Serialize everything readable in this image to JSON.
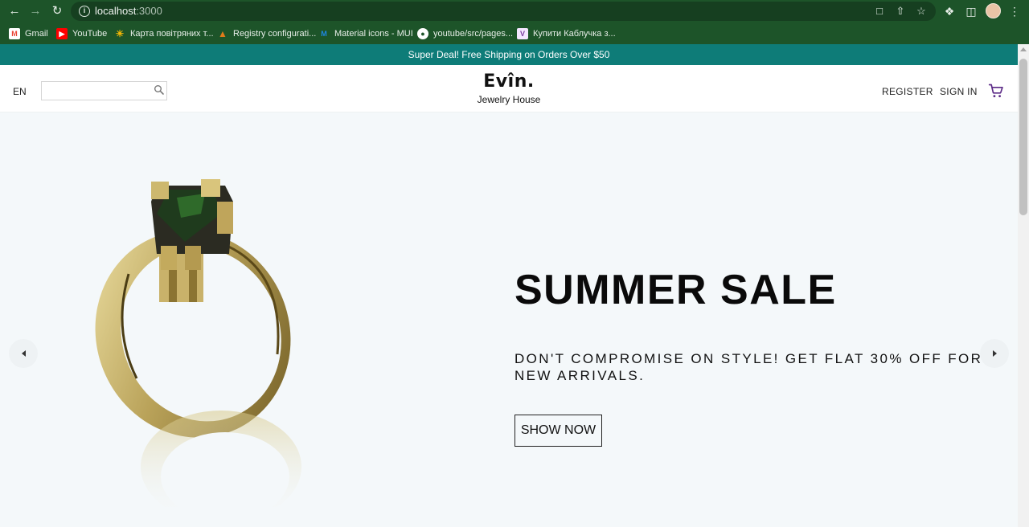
{
  "browser": {
    "url_host": "localhost",
    "url_port": ":3000",
    "bookmarks": [
      {
        "label": "Gmail",
        "icon": "gmail-icon",
        "color": "#ea4335"
      },
      {
        "label": "YouTube",
        "icon": "youtube-icon",
        "color": "#ff0000"
      },
      {
        "label": "Карта повітряних т...",
        "icon": "map-icon",
        "color": "#f2b705"
      },
      {
        "label": "Registry configurati...",
        "icon": "registry-icon",
        "color": "#e07b1a"
      },
      {
        "label": "Material icons - MUI",
        "icon": "mui-icon",
        "color": "#1e88e5"
      },
      {
        "label": "youtube/src/pages...",
        "icon": "github-icon",
        "color": "#ffffff"
      },
      {
        "label": "Купити Каблучка з...",
        "icon": "shop-icon",
        "color": "#7b3fa0"
      }
    ]
  },
  "announcement": "Super Deal! Free Shipping on Orders Over $50",
  "header": {
    "language": "EN",
    "search_placeholder": "",
    "logo_name": "Evîn.",
    "logo_subtitle": "Jewelry House",
    "register": "REGISTER",
    "sign_in": "SIGN IN"
  },
  "slide": {
    "title": "SUMMER SALE",
    "description": "DON'T COMPROMISE ON STYLE! GET FLAT 30% OFF FOR NEW ARRIVALS.",
    "button": "SHOW NOW"
  },
  "colors": {
    "browser_frame": "#1d5429",
    "announcement_bg": "#0e7c78",
    "cart_icon": "#5b2a86",
    "slide_bg": "#f4f8fa"
  }
}
